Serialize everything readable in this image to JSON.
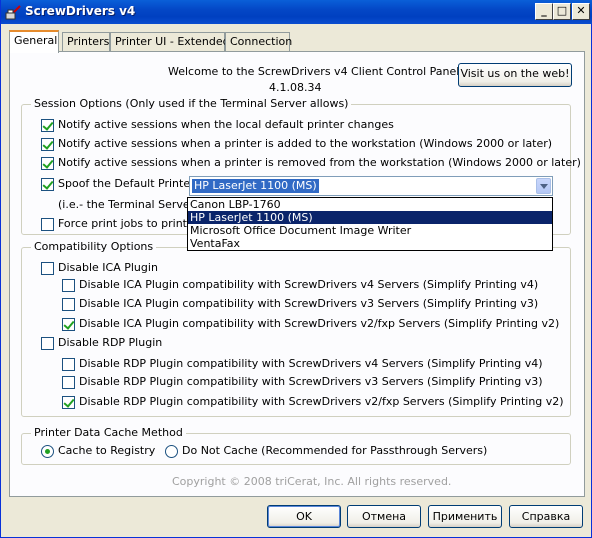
{
  "window": {
    "title": "ScrewDrivers v4",
    "minimize_label": "_",
    "maximize_label": "□",
    "close_label": "✕"
  },
  "tabs": [
    {
      "label": "General",
      "active": true
    },
    {
      "label": "Printers",
      "active": false
    },
    {
      "label": "Printer UI - Extended",
      "active": false
    },
    {
      "label": "Connection",
      "active": false
    }
  ],
  "header": {
    "welcome": "Welcome to the ScrewDrivers v4 Client Control Panel!",
    "version": "4.1.08.34",
    "visit_button": "Visit us on the web!"
  },
  "session": {
    "title": "Session Options (Only used if the Terminal Server allows)",
    "opt1": {
      "label": "Notify active sessions when the local default printer changes",
      "checked": true
    },
    "opt2": {
      "label": "Notify active sessions when a printer is added to the workstation (Windows 2000 or later)",
      "checked": true
    },
    "opt3": {
      "label": "Notify active sessions when a printer is removed from the workstation (Windows 2000 or later)",
      "checked": true
    },
    "spoof": {
      "label": "Spoof the Default Printer:",
      "checked": true,
      "value": "HP LaserJet 1100 (MS)"
    },
    "note": "(i.e.-  the Terminal Server w",
    "force": {
      "label": "Force print jobs to print in",
      "checked": false
    },
    "dropdown_options": [
      {
        "label": "Canon LBP-1760",
        "highlighted": false
      },
      {
        "label": "HP LaserJet 1100 (MS)",
        "highlighted": true
      },
      {
        "label": "Microsoft Office Document Image Writer",
        "highlighted": false
      },
      {
        "label": "VentaFax",
        "highlighted": false
      }
    ]
  },
  "compat": {
    "title": "Compatibility Options",
    "ica": {
      "label": "Disable ICA Plugin",
      "checked": false
    },
    "ica_v4": {
      "label": "Disable ICA Plugin compatibility with ScrewDrivers v4 Servers (Simplify Printing v4)",
      "checked": false
    },
    "ica_v3": {
      "label": "Disable ICA Plugin compatibility with ScrewDrivers v3 Servers (Simplify Printing v3)",
      "checked": false
    },
    "ica_v2": {
      "label": "Disable ICA Plugin compatibility with ScrewDrivers v2/fxp Servers (Simplify Printing v2)",
      "checked": true
    },
    "rdp": {
      "label": "Disable RDP Plugin",
      "checked": false
    },
    "rdp_v4": {
      "label": "Disable RDP Plugin compatibility with ScrewDrivers v4 Servers (Simplify Printing v4)",
      "checked": false
    },
    "rdp_v3": {
      "label": "Disable RDP Plugin compatibility with ScrewDrivers v3 Servers (Simplify Printing v3)",
      "checked": false
    },
    "rdp_v2": {
      "label": "Disable RDP Plugin compatibility with ScrewDrivers v2/fxp Servers (Simplify Printing v2)",
      "checked": true
    }
  },
  "cache": {
    "title": "Printer Data Cache Method",
    "registry": {
      "label": "Cache to Registry",
      "selected": true
    },
    "nocache": {
      "label": "Do Not Cache (Recommended for Passthrough Servers)",
      "selected": false
    }
  },
  "copyright": "Copyright © 2008 triCerat, Inc. All rights reserved.",
  "buttons": {
    "ok": "OK",
    "cancel": "Отмена",
    "apply": "Применить",
    "help": "Справка"
  }
}
